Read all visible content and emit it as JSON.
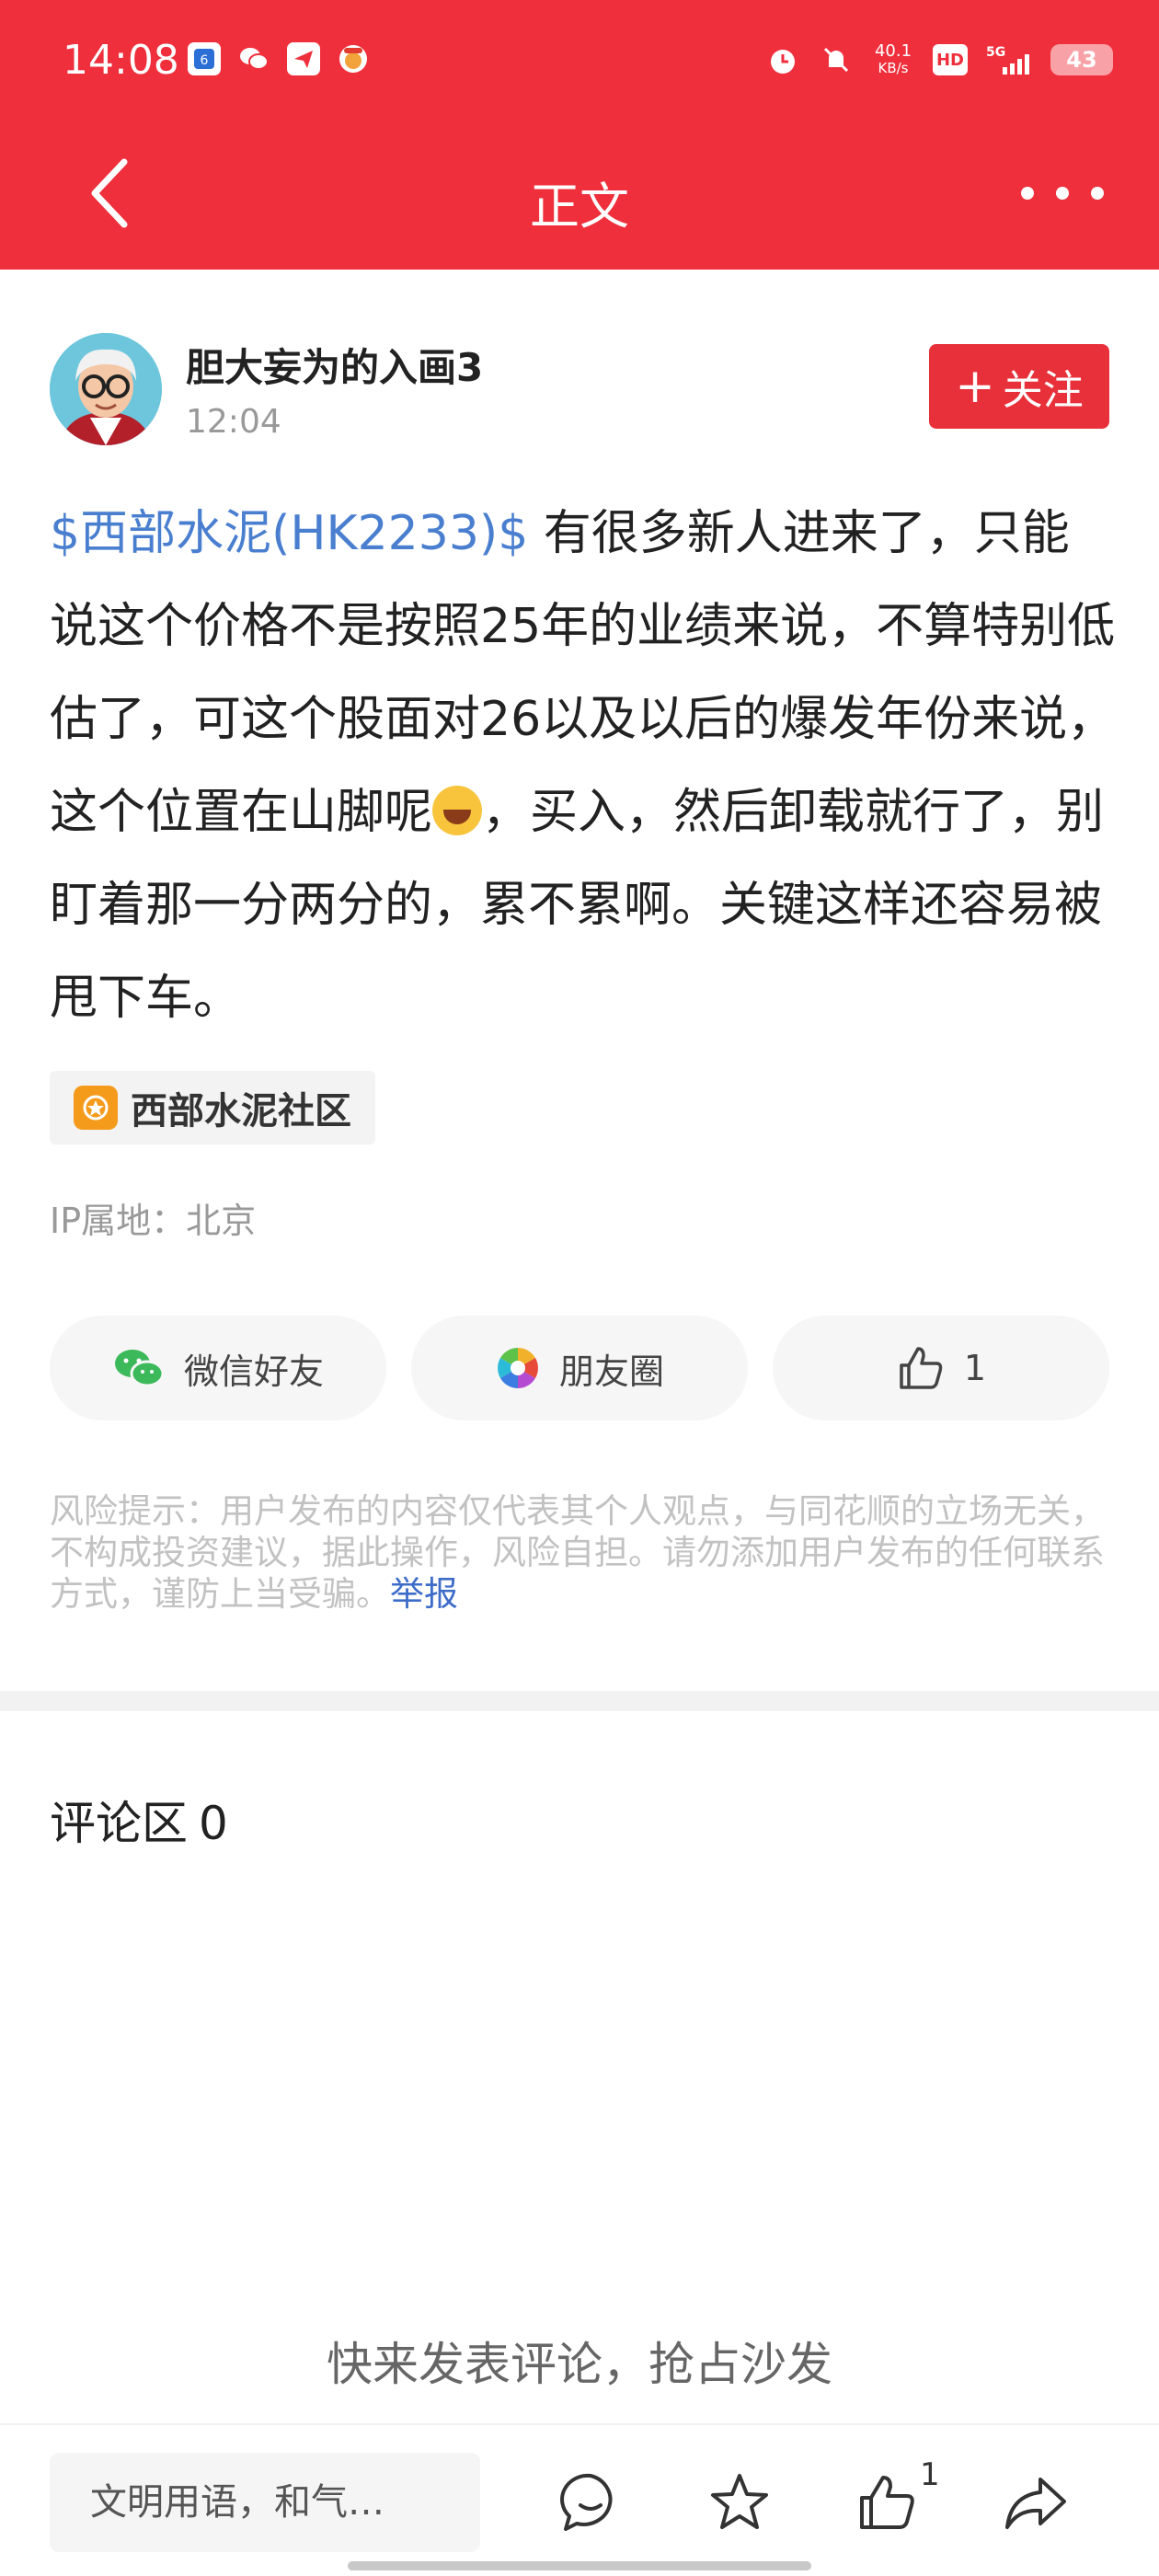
{
  "status_bar": {
    "time": "14:08",
    "network_speed_value": "40.1",
    "network_speed_unit": "KB/s",
    "hd_label": "HD",
    "signal_label": "5G",
    "battery": "43"
  },
  "nav": {
    "title": "正文"
  },
  "author": {
    "name": "胆大妄为的入画3",
    "time": "12:04",
    "follow_label": "关注"
  },
  "post": {
    "stock_tag": "$西部水泥(HK2233)$",
    "text_before_emoji": " 有很多新人进来了，只能说这个价格不是按照25年的业绩来说，不算特别低估了，可这个股面对26以及以后的爆发年份来说，这个位置在山脚呢",
    "text_after_emoji": "，买入，然后卸载就行了，别盯着那一分两分的，累不累啊。关键这样还容易被甩下车。"
  },
  "topic": {
    "label": "西部水泥社区"
  },
  "ip_location": "IP属地：北京",
  "share": {
    "wechat_label": "微信好友",
    "moments_label": "朋友圈",
    "like_count": "1"
  },
  "risk": {
    "text": "风险提示：用户发布的内容仅代表其个人观点，与同花顺的立场无关，不构成投资建议，据此操作，风险自担。请勿添加用户发布的任何联系方式，谨防上当受骗。",
    "report_label": "举报"
  },
  "comments": {
    "title": "评论区",
    "count": "0",
    "empty_hint": "快来发表评论，抢占沙发"
  },
  "bottom_bar": {
    "input_placeholder": "文明用语，和气…",
    "like_count": "1"
  },
  "colors": {
    "header_red": "#ef2f3c",
    "follow_red": "#e8303a",
    "stock_blue": "#4a7fd0",
    "report_blue": "#3e6cc9"
  }
}
